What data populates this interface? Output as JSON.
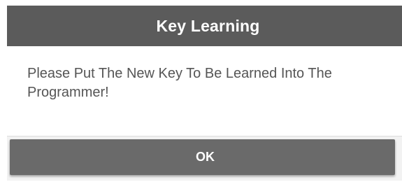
{
  "dialog": {
    "title": "Key Learning",
    "message": "Please Put The New Key To Be Learned Into The Programmer!",
    "ok_label": "OK"
  },
  "colors": {
    "title_bar": "#5b5b5b",
    "button": "#6a6a6a",
    "message_text": "#555555"
  }
}
